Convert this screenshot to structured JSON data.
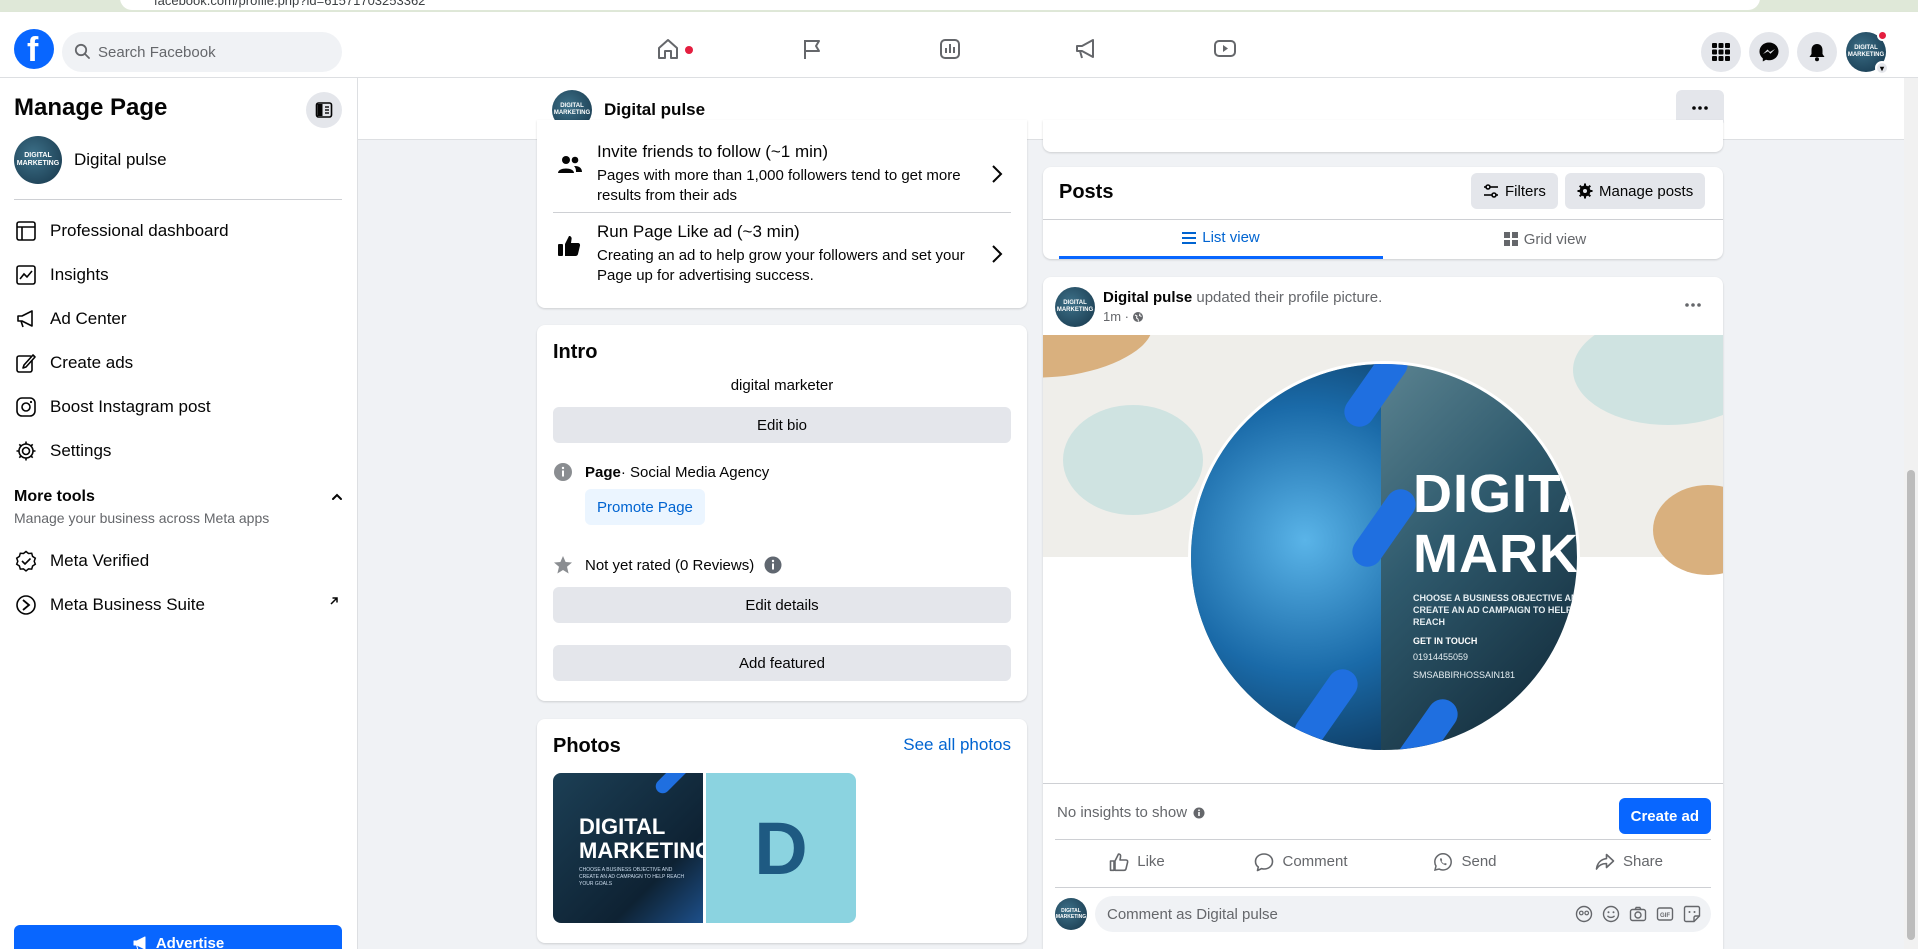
{
  "browser": {
    "url": "facebook.com/profile.php?id=61571703253362"
  },
  "topnav": {
    "logo_letter": "f",
    "search_placeholder": "Search Facebook"
  },
  "sidebar": {
    "title": "Manage Page",
    "page_name": "Digital pulse",
    "avatar_text": "DIGITAL MARKETING",
    "items": [
      {
        "label": "Professional dashboard",
        "icon": "dashboard-icon"
      },
      {
        "label": "Insights",
        "icon": "insights-icon"
      },
      {
        "label": "Ad Center",
        "icon": "megaphone-icon"
      },
      {
        "label": "Create ads",
        "icon": "pencil-icon"
      },
      {
        "label": "Boost Instagram post",
        "icon": "instagram-icon"
      },
      {
        "label": "Settings",
        "icon": "gear-icon"
      }
    ],
    "more_tools": {
      "title": "More tools",
      "subtitle": "Manage your business across Meta apps",
      "items": [
        {
          "label": "Meta Verified",
          "icon": "verified-badge-icon"
        },
        {
          "label": "Meta Business Suite",
          "icon": "business-suite-icon"
        }
      ]
    },
    "advertise_label": "Advertise"
  },
  "pagebar": {
    "page_name": "Digital pulse"
  },
  "tasks": [
    {
      "title": "Invite friends to follow (~1 min)",
      "desc": "Pages with more than 1,000 followers tend to get more results from their ads"
    },
    {
      "title": "Run Page Like ad (~3 min)",
      "desc": "Creating an ad to help grow your followers and set your Page up for advertising success."
    }
  ],
  "intro": {
    "title": "Intro",
    "bio": "digital marketer",
    "edit_bio": "Edit bio",
    "page_label": "Page",
    "page_category": " · Social Media Agency",
    "promote": "Promote Page",
    "rating": "Not yet rated (0 Reviews)",
    "edit_details": "Edit details",
    "add_featured": "Add featured"
  },
  "photos": {
    "title": "Photos",
    "see_all": "See all photos",
    "photo1_title_1": "DIGITAL",
    "photo1_title_2": "MARKETING",
    "photo1_sub": "CHOOSE A BUSINESS OBJECTIVE AND CREATE AN AD CAMPAIGN TO HELP REACH YOUR GOALS",
    "photo2_letter": "D"
  },
  "posts": {
    "title": "Posts",
    "filters": "Filters",
    "manage": "Manage posts",
    "list_view": "List view",
    "grid_view": "Grid view"
  },
  "post": {
    "author": "Digital pulse",
    "action": " updated their profile picture.",
    "time": "1m · ",
    "image": {
      "line1": "DIGITAL",
      "line2": "MARKE",
      "sub": "CHOOSE A BUSINESS OBJECTIVE AND CREATE AN AD CAMPAIGN TO HELP REACH",
      "get_in_touch": "GET IN TOUCH",
      "phone": "01914455059",
      "email": "SMSABBIRHOSSAIN181"
    },
    "no_insights": "No insights to show",
    "create_ad": "Create ad",
    "actions": {
      "like": "Like",
      "comment": "Comment",
      "send": "Send",
      "share": "Share"
    },
    "comment_placeholder": "Comment as Digital pulse"
  },
  "colors": {
    "brand": "#0866ff",
    "link": "#0064d1",
    "notification": "#e41e3f"
  }
}
